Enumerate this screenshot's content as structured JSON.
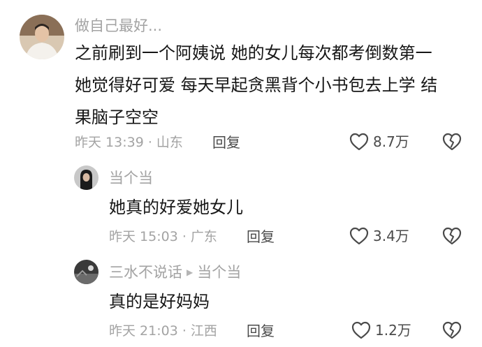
{
  "comments": [
    {
      "user": "做自己最好...",
      "text_lines": [
        "之前刷到一个阿姨说 她的女儿每次都考倒数第一",
        "她觉得好可爱 每天早起贪黑背个小书包去上学 结",
        "果脑子空空"
      ],
      "meta": "昨天 13:39 · 山东",
      "reply_label": "回复",
      "likes": "8.7万"
    },
    {
      "user": "当个当",
      "text": "她真的好爱她女儿",
      "meta": "昨天 15:03 · 广东",
      "reply_label": "回复",
      "likes": "3.4万"
    },
    {
      "user": "三水不说话",
      "reply_to": "当个当",
      "text": "真的是好妈妈",
      "meta": "昨天 21:03 · 江西",
      "reply_label": "回复",
      "likes": "1.2万"
    }
  ],
  "icons": {
    "like": "heart-outline-icon",
    "dislike": "broken-heart-icon",
    "reply_arrow": "triangle-right-icon"
  },
  "colors": {
    "text": "#161616",
    "muted": "#a3a3a3",
    "action": "#4a4a4a"
  }
}
